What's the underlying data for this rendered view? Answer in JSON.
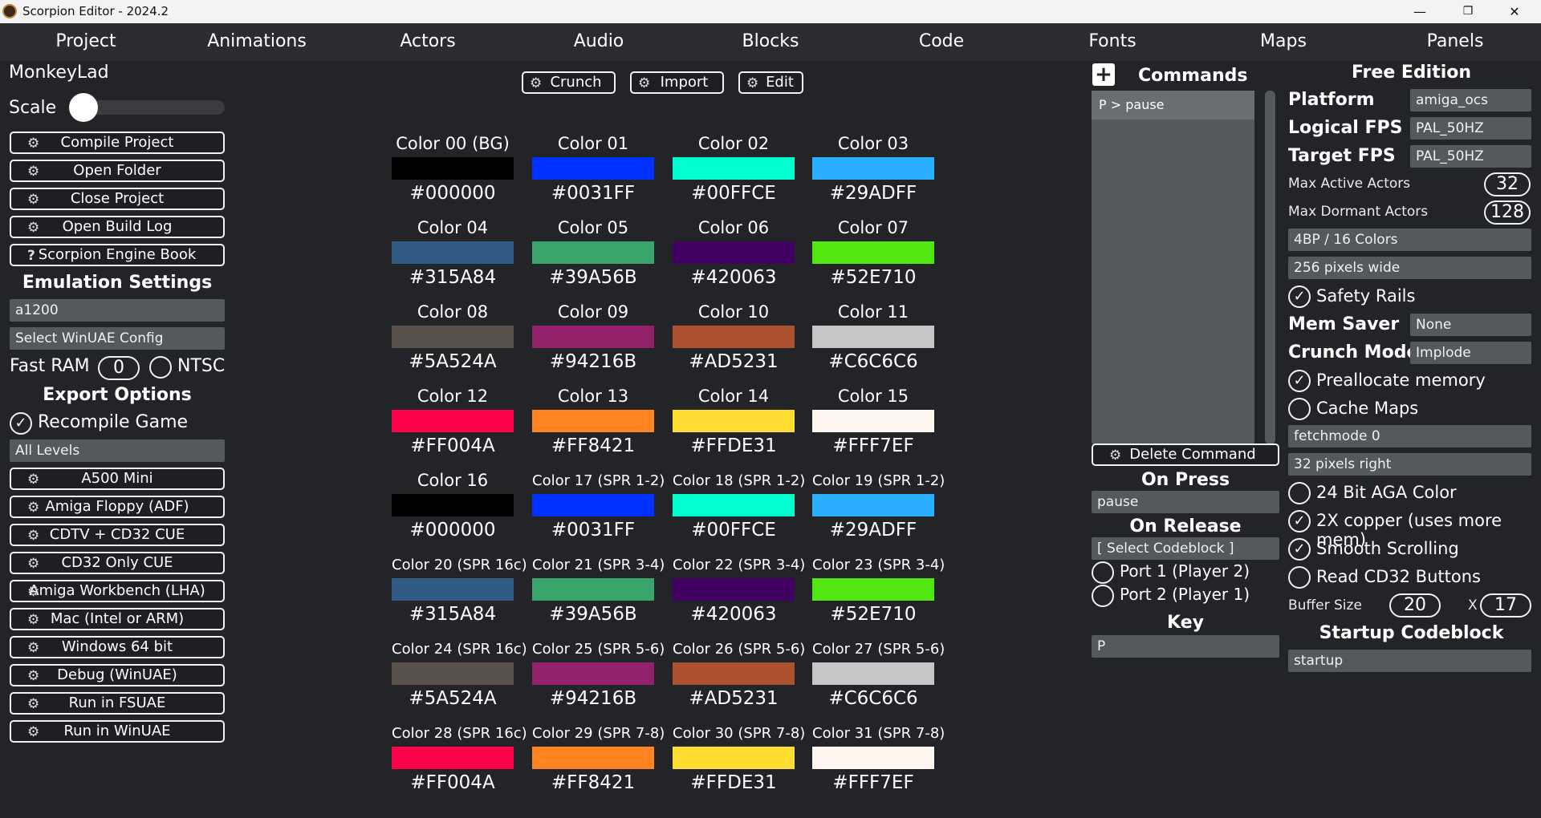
{
  "window": {
    "title": "Scorpion Editor - 2024.2",
    "minimize": "—",
    "maximize": "❐",
    "close": "✕"
  },
  "menu": [
    "Project",
    "Animations",
    "Actors",
    "Audio",
    "Blocks",
    "Code",
    "Fonts",
    "Maps",
    "Panels"
  ],
  "left": {
    "project_name": "MonkeyLad",
    "scale_label": "Scale",
    "scale_value": 0.0,
    "actions": [
      "Compile Project",
      "Open Folder",
      "Close Project",
      "Open Build Log"
    ],
    "book_button": "Scorpion Engine Book",
    "book_icon": "?",
    "emulation_heading": "Emulation Settings",
    "emulator_model": "a1200",
    "winuae_config": "Select WinUAE Config",
    "fast_ram_label": "Fast RAM",
    "fast_ram_value": "0",
    "ntsc_label": "NTSC",
    "export_heading": "Export Options",
    "recompile_label": "Recompile Game",
    "levels_select": "All Levels",
    "exports": [
      "A500 Mini",
      "Amiga Floppy (ADF)",
      "CDTV + CD32 CUE",
      "CD32 Only CUE",
      "Amiga Workbench (LHA)",
      "Mac (Intel or ARM)",
      "Windows 64 bit",
      "Debug (WinUAE)",
      "Run in FSUAE",
      "Run in WinUAE"
    ]
  },
  "palette_toolbar": [
    "Crunch",
    "Import",
    "Edit"
  ],
  "palette": [
    {
      "name": "Color 00 (BG)",
      "hex": "#000000"
    },
    {
      "name": "Color 01",
      "hex": "#0031FF"
    },
    {
      "name": "Color 02",
      "hex": "#00FFCE"
    },
    {
      "name": "Color 03",
      "hex": "#29ADFF"
    },
    {
      "name": "Color 04",
      "hex": "#315A84"
    },
    {
      "name": "Color 05",
      "hex": "#39A56B"
    },
    {
      "name": "Color 06",
      "hex": "#420063"
    },
    {
      "name": "Color 07",
      "hex": "#52E710"
    },
    {
      "name": "Color 08",
      "hex": "#5A524A"
    },
    {
      "name": "Color 09",
      "hex": "#94216B"
    },
    {
      "name": "Color 10",
      "hex": "#AD5231"
    },
    {
      "name": "Color 11",
      "hex": "#C6C6C6"
    },
    {
      "name": "Color 12",
      "hex": "#FF004A"
    },
    {
      "name": "Color 13",
      "hex": "#FF8421"
    },
    {
      "name": "Color 14",
      "hex": "#FFDE31"
    },
    {
      "name": "Color 15",
      "hex": "#FFF7EF"
    },
    {
      "name": "Color 16",
      "hex": "#000000"
    },
    {
      "name": "Color 17 (SPR 1-2)",
      "hex": "#0031FF"
    },
    {
      "name": "Color 18 (SPR 1-2)",
      "hex": "#00FFCE"
    },
    {
      "name": "Color 19 (SPR 1-2)",
      "hex": "#29ADFF"
    },
    {
      "name": "Color 20 (SPR 16c)",
      "hex": "#315A84"
    },
    {
      "name": "Color 21 (SPR 3-4)",
      "hex": "#39A56B"
    },
    {
      "name": "Color 22 (SPR 3-4)",
      "hex": "#420063"
    },
    {
      "name": "Color 23 (SPR 3-4)",
      "hex": "#52E710"
    },
    {
      "name": "Color 24 (SPR 16c)",
      "hex": "#5A524A"
    },
    {
      "name": "Color 25 (SPR 5-6)",
      "hex": "#94216B"
    },
    {
      "name": "Color 26 (SPR 5-6)",
      "hex": "#AD5231"
    },
    {
      "name": "Color 27 (SPR 5-6)",
      "hex": "#C6C6C6"
    },
    {
      "name": "Color 28 (SPR 16c)",
      "hex": "#FF004A"
    },
    {
      "name": "Color 29 (SPR 7-8)",
      "hex": "#FF8421"
    },
    {
      "name": "Color 30 (SPR 7-8)",
      "hex": "#FFDE31"
    },
    {
      "name": "Color 31 (SPR 7-8)",
      "hex": "#FFF7EF"
    }
  ],
  "commands": {
    "add_icon": "+",
    "heading": "Commands",
    "items": [
      "P > pause"
    ],
    "delete_button": "Delete Command",
    "on_press_label": "On Press",
    "on_press_value": "pause",
    "on_release_label": "On Release",
    "on_release_value": "[ Select Codeblock ]",
    "port1": "Port 1 (Player 2)",
    "port2": "Port 2 (Player 1)",
    "key_label": "Key",
    "key_value": "P"
  },
  "settings": {
    "heading": "Free Edition",
    "platform_label": "Platform",
    "platform_value": "amiga_ocs",
    "logical_fps_label": "Logical FPS",
    "logical_fps_value": "PAL_50HZ",
    "target_fps_label": "Target FPS",
    "target_fps_value": "PAL_50HZ",
    "max_active_label": "Max Active Actors",
    "max_active_value": "32",
    "max_dormant_label": "Max Dormant Actors",
    "max_dormant_value": "128",
    "colors_mode": "4BP / 16 Colors",
    "width_mode": "256 pixels wide",
    "safety_rails": "Safety Rails",
    "mem_saver_label": "Mem Saver",
    "mem_saver_value": "None",
    "crunch_label": "Crunch Mode",
    "crunch_value": "Implode",
    "preallocate": "Preallocate memory",
    "cache_maps": "Cache Maps",
    "fetchmode": "fetchmode 0",
    "pixels_right": "32 pixels right",
    "aga_color": "24 Bit AGA Color",
    "copper": "2X copper (uses more mem)",
    "smooth": "Smooth Scrolling",
    "cd32_buttons": "Read CD32 Buttons",
    "buffer_label": "Buffer Size",
    "buffer_x": "20",
    "buffer_sep": "X",
    "buffer_y": "17",
    "startup_heading": "Startup Codeblock",
    "startup_value": "startup",
    "check_mark": "✓"
  }
}
